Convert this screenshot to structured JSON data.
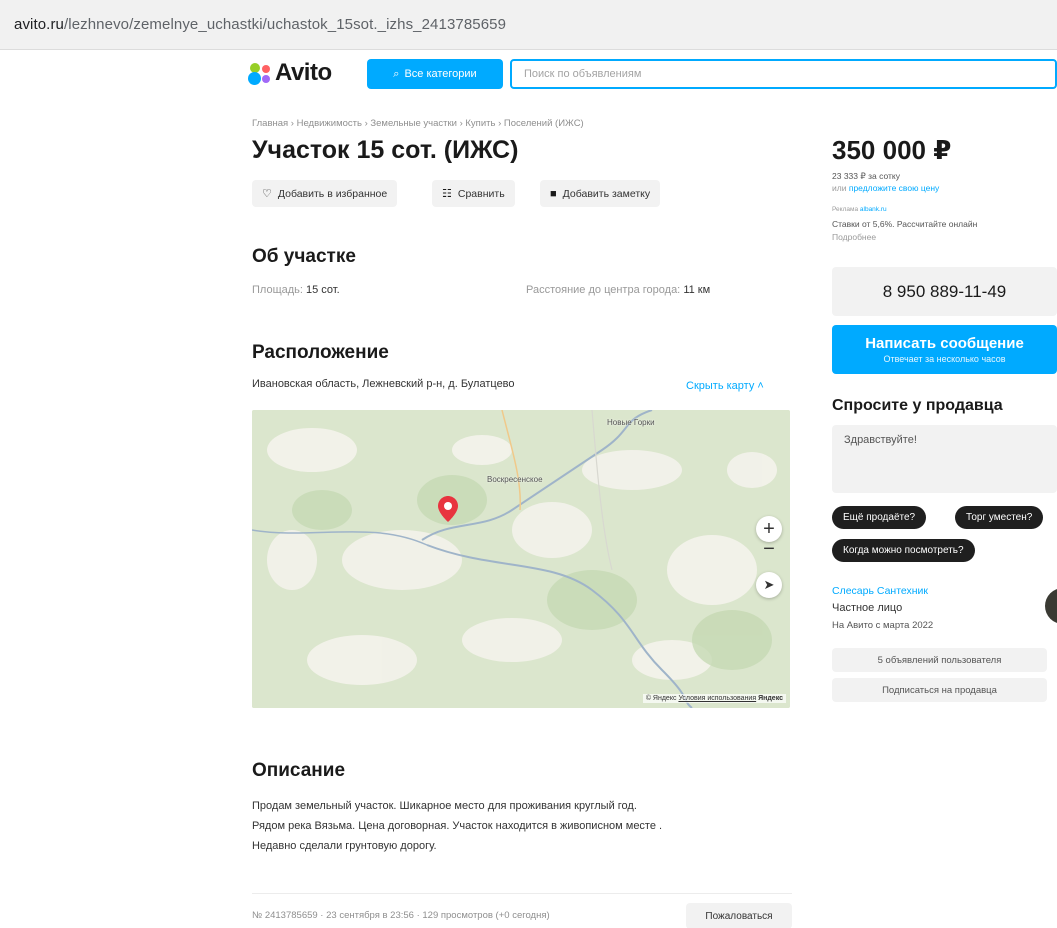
{
  "browser": {
    "url_host": "avito.ru",
    "url_path": "/lezhnevo/zemelnye_uchastki/uchastok_15sot._izhs_2413785659"
  },
  "header": {
    "logo_text": "Avito",
    "categories_label": "Все категории",
    "search_placeholder": "Поиск по объявлениям"
  },
  "breadcrumb": "Главная › Недвижимость › Земельные участки › Купить › Поселений (ИЖС)",
  "listing": {
    "title": "Участок 15 сот. (ИЖС)",
    "actions": {
      "favorite": "Добавить в избранное",
      "compare": "Сравнить",
      "note": "Добавить заметку"
    }
  },
  "about": {
    "heading": "Об участке",
    "area_label": "Площадь:",
    "area_value": "15 сот.",
    "distance_label": "Расстояние до центра города:",
    "distance_value": "11 км"
  },
  "location": {
    "heading": "Расположение",
    "address": "Ивановская область, Лежневский р-н, д. Булатцево",
    "hide_map": "Скрыть карту ˄",
    "map": {
      "label_top": "Новые Горки",
      "label_mid": "Воскресенское",
      "credit_prefix": "© Яндекс",
      "credit_terms": "Условия использования",
      "credit_brand": "Яндекс"
    }
  },
  "description": {
    "heading": "Описание",
    "line1": "Продам земельный участок. Шикарное место для проживания круглый год.",
    "line2": "Рядом река Вязьма. Цена договорная. Участок находится в живописном месте .",
    "line3": "Недавно сделали грунтовую дорогу."
  },
  "footer": {
    "meta": "№ 2413785659 · 23 сентября в 23:56 · 129 просмотров (+0 сегодня)",
    "complain": "Пожаловаться"
  },
  "sidebar": {
    "price": "350 000 ₽",
    "per_sotka": "23 333 ₽ за сотку",
    "offer_prefix": "или",
    "offer_link": "предложите свою цену",
    "ad_label": "Реклама",
    "ad_source": "albank.ru",
    "ad_text": "Ставки от 5,6%. Рассчитайте онлайн",
    "ad_more": "Подробнее",
    "phone": "8 950 889-11-49",
    "write_main": "Написать сообщение",
    "write_sub": "Отвечает за несколько часов",
    "ask_heading": "Спросите у продавца",
    "message_value": "Здравствуйте!",
    "chips": [
      "Ещё продаёте?",
      "Торг уместен?",
      "Когда можно посмотреть?"
    ],
    "seller_name": "Слесарь Сантехник",
    "seller_type": "Частное лицо",
    "seller_since": "На Авито с марта 2022",
    "user_ads": "5 объявлений пользователя",
    "subscribe": "Подписаться на продавца"
  },
  "colors": {
    "accent": "#00aaff",
    "pin": "#e8343f",
    "chip_bg": "#1f1f1f"
  }
}
